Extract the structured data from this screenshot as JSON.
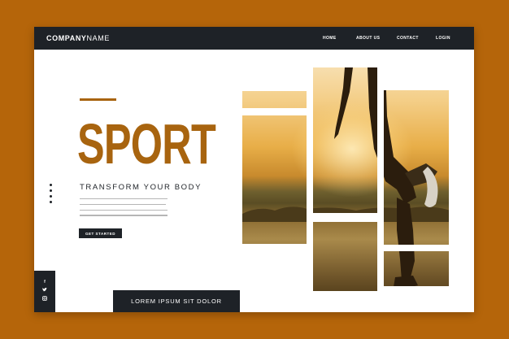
{
  "header": {
    "brand_bold": "COMPANY",
    "brand_light": "NAME",
    "nav": [
      "HOME",
      "ABOUT US",
      "CONTACT",
      "LOGIN"
    ]
  },
  "hero": {
    "title": "SPORT",
    "subtitle": "TRANSFORM YOUR BODY",
    "cta_label": "GET STARTED"
  },
  "social": [
    "f",
    "t",
    "i"
  ],
  "social_icons": [
    "facebook-icon",
    "twitter-icon",
    "instagram-icon"
  ],
  "banner": {
    "label": "LOREM IPSUM SIT DOLOR"
  },
  "colors": {
    "background": "#b5650a",
    "accent": "#a8640f",
    "dark": "#1e2227",
    "page": "#ffffff"
  }
}
